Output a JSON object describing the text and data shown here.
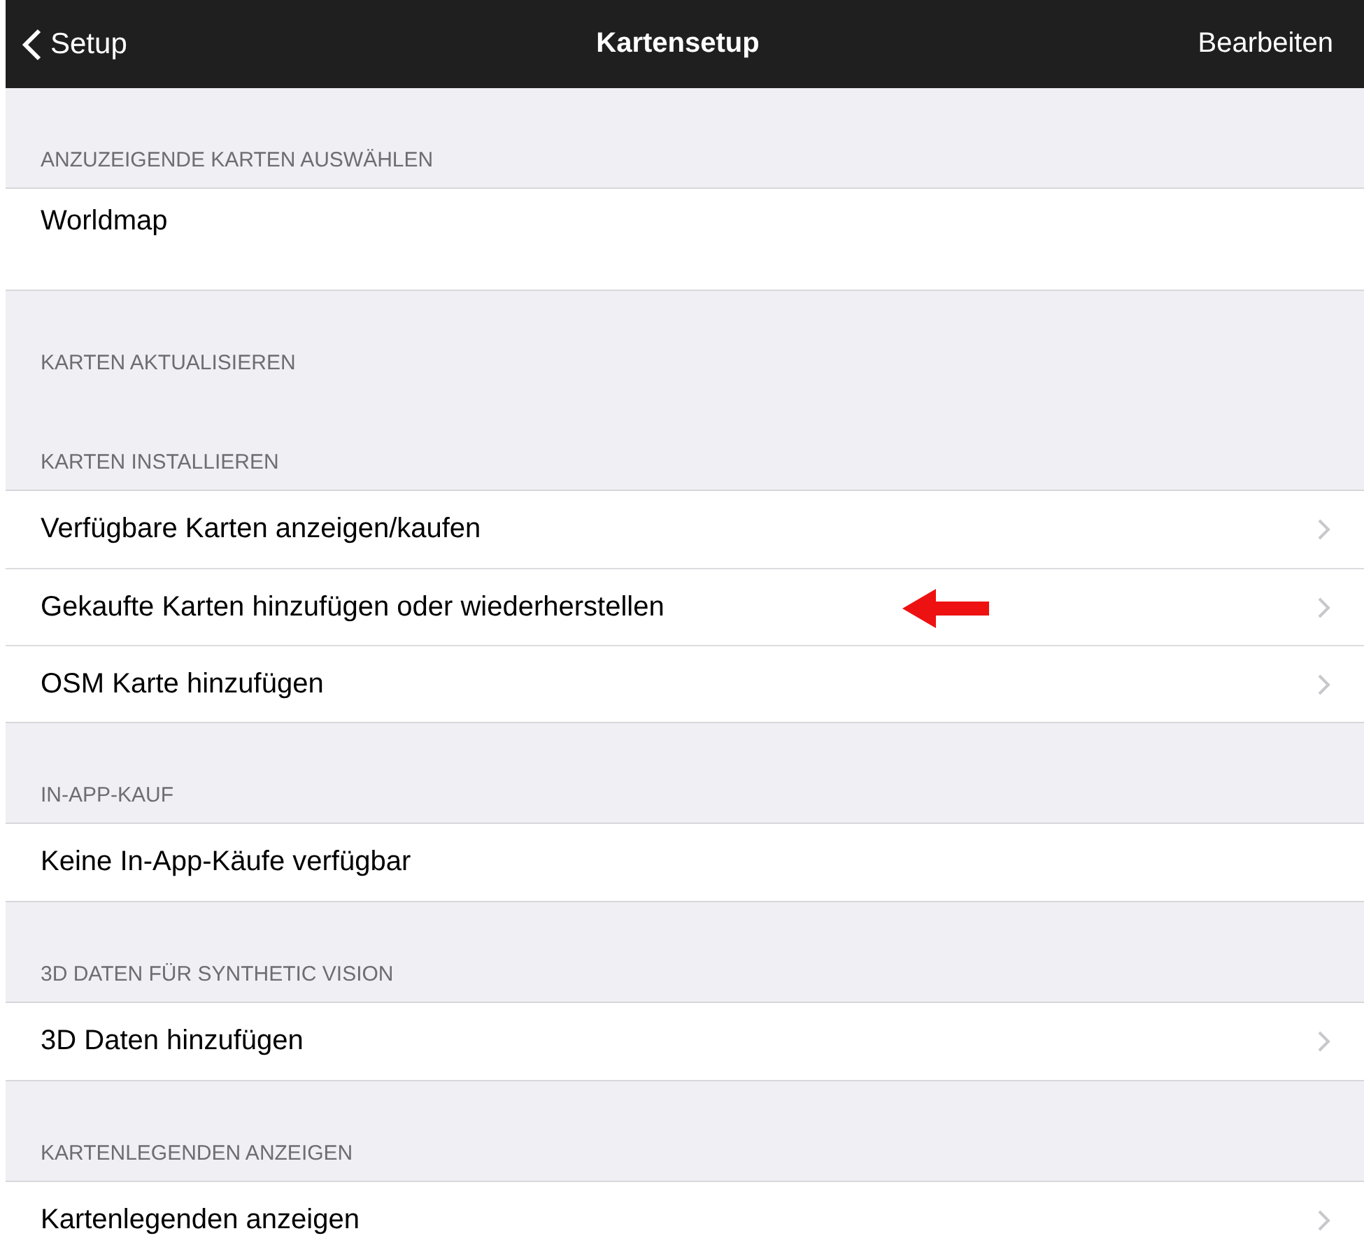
{
  "nav": {
    "back": "Setup",
    "title": "Kartensetup",
    "action": "Bearbeiten"
  },
  "sections": [
    {
      "header": "ANZUZEIGENDE KARTEN AUSWÄHLEN",
      "rows": [
        {
          "label": "Worldmap",
          "kind": "choice",
          "marked": false
        }
      ]
    },
    {
      "header": "KARTEN AKTUALISIEREN"
    },
    {
      "header": "KARTEN INSTALLIEREN",
      "rows": [
        {
          "label": "Verfügbare Karten anzeigen/kaufen",
          "kind": "link",
          "marked": false
        },
        {
          "label": "Gekaufte Karten hinzufügen oder wiederherstellen",
          "kind": "link",
          "marked": true
        },
        {
          "label": "OSM Karte hinzufügen",
          "kind": "link",
          "marked": false
        }
      ]
    },
    {
      "header": "IN-APP-KAUF",
      "rows": [
        {
          "label": "Keine In-App-Käufe verfügbar",
          "kind": "info",
          "marked": false
        }
      ]
    },
    {
      "header": "3D DATEN FÜR SYNTHETIC VISION",
      "rows": [
        {
          "label": "3D Daten hinzufügen",
          "kind": "link",
          "marked": false
        }
      ]
    },
    {
      "header": "KARTENLEGENDEN ANZEIGEN",
      "rows": [
        {
          "label": "Kartenlegenden anzeigen",
          "kind": "link",
          "marked": false
        }
      ]
    }
  ]
}
